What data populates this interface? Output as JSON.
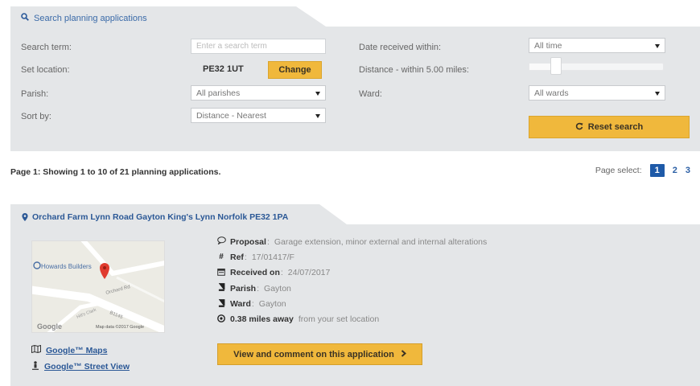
{
  "search": {
    "tab_label": "Search planning applications",
    "term_label": "Search term:",
    "term_placeholder": "Enter a search term",
    "location_label": "Set location:",
    "location_value": "PE32 1UT",
    "change_label": "Change",
    "parish_label": "Parish:",
    "parish_value": "All parishes",
    "sort_label": "Sort by:",
    "sort_value": "Distance - Nearest",
    "date_label": "Date received within:",
    "date_value": "All time",
    "distance_label": "Distance - within 5.00 miles:",
    "distance_fraction": 0.2,
    "ward_label": "Ward:",
    "ward_value": "All wards",
    "reset_label": "Reset search"
  },
  "results": {
    "summary": "Page 1: Showing 1 to 10 of 21 planning applications.",
    "page_select_label": "Page select:",
    "pages": [
      "1",
      "2",
      "3"
    ],
    "current_page": "1"
  },
  "application": {
    "address": "Orchard Farm Lynn Road Gayton King's Lynn Norfolk PE32 1PA",
    "map": {
      "place_label": "Howards Builders",
      "road_label_1": "Orchard Rd",
      "road_label_2": "B1145",
      "road_label_3": "Hill's Clark",
      "google_logo": "Google",
      "map_data": "Map data ©2017 Google"
    },
    "links": {
      "maps": "Google™ Maps",
      "street_view": "Google™ Street View"
    },
    "proposal_key": "Proposal",
    "proposal_value": "Garage extension, minor external and internal alterations",
    "ref_key": "Ref",
    "ref_value": "17/01417/F",
    "received_key": "Received on",
    "received_value": "24/07/2017",
    "parish_key": "Parish",
    "parish_value": "Gayton",
    "ward_key": "Ward",
    "ward_value": "Gayton",
    "distance_key": "0.38 miles away",
    "distance_value": "from your set location",
    "view_button": "View and comment on this application"
  },
  "colors": {
    "panel_bg": "#e4e6e8",
    "accent_yellow": "#f0b83c",
    "link_blue": "#2b5896",
    "page_active": "#1e5aa8"
  },
  "icons": {
    "search": "magnifier-icon",
    "reset": "refresh-icon",
    "pin": "map-pin-icon",
    "proposal": "speech-bubble-icon",
    "ref": "hash-icon",
    "received": "calendar-icon",
    "parish": "book-icon",
    "ward": "book-icon",
    "distance": "target-icon",
    "maps": "map-icon",
    "street_view": "street-view-icon",
    "chevron": "chevron-right-icon"
  }
}
